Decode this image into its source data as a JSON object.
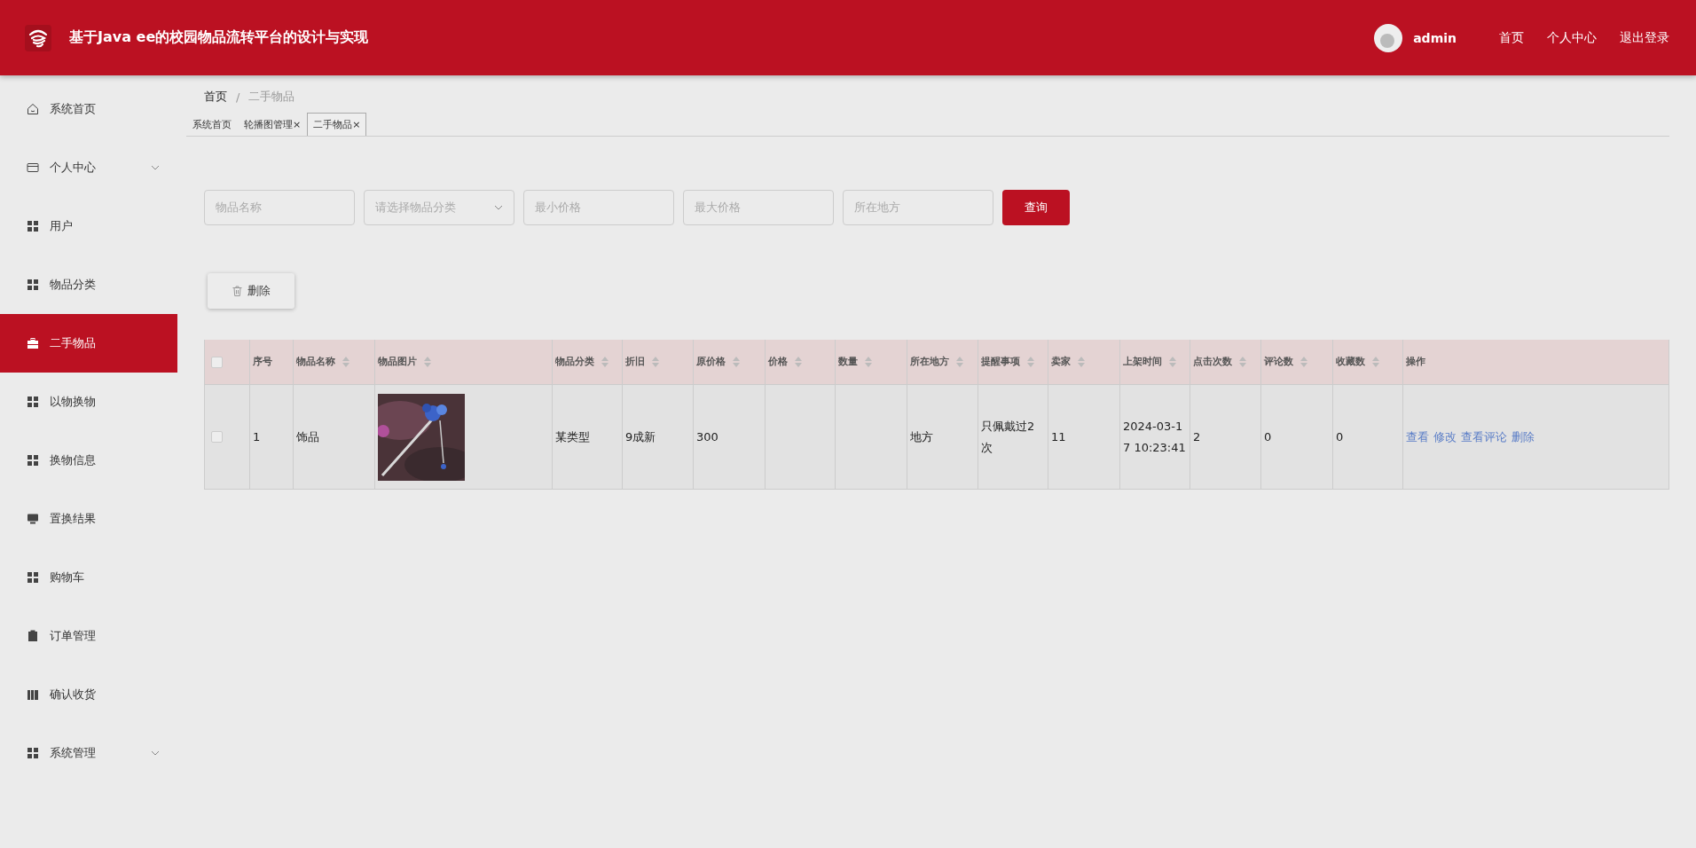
{
  "header": {
    "title": "基于Java ee的校园物品流转平台的设计与实现",
    "user": "admin",
    "links": [
      "首页",
      "个人中心",
      "退出登录"
    ]
  },
  "sidebar": {
    "items": [
      {
        "label": "系统首页",
        "kind": "home",
        "selected": false,
        "expandable": false
      },
      {
        "label": "个人中心",
        "kind": "wallet",
        "selected": false,
        "expandable": true
      },
      {
        "label": "用户",
        "kind": "grid",
        "selected": false,
        "expandable": false
      },
      {
        "label": "物品分类",
        "kind": "grid",
        "selected": false,
        "expandable": false
      },
      {
        "label": "二手物品",
        "kind": "briefcase",
        "selected": true,
        "expandable": false
      },
      {
        "label": "以物换物",
        "kind": "grid",
        "selected": false,
        "expandable": false
      },
      {
        "label": "换物信息",
        "kind": "grid",
        "selected": false,
        "expandable": false
      },
      {
        "label": "置换结果",
        "kind": "monitor",
        "selected": false,
        "expandable": false
      },
      {
        "label": "购物车",
        "kind": "grid",
        "selected": false,
        "expandable": false
      },
      {
        "label": "订单管理",
        "kind": "clipboard",
        "selected": false,
        "expandable": false
      },
      {
        "label": "确认收货",
        "kind": "book",
        "selected": false,
        "expandable": false
      },
      {
        "label": "系统管理",
        "kind": "grid",
        "selected": false,
        "expandable": true
      }
    ]
  },
  "breadcrumb": {
    "items": [
      "首页",
      "二手物品"
    ],
    "separator": "/"
  },
  "tabs": [
    {
      "label": "系统首页",
      "selected": false,
      "closable": false
    },
    {
      "label": "轮播图管理",
      "selected": false,
      "closable": true
    },
    {
      "label": "二手物品",
      "selected": true,
      "closable": true
    }
  ],
  "close_mark": "×",
  "filters": [
    {
      "kind": "input",
      "placeholder": "物品名称"
    },
    {
      "kind": "select",
      "placeholder": "请选择物品分类"
    },
    {
      "kind": "input",
      "placeholder": "最小价格"
    },
    {
      "kind": "input",
      "placeholder": "最大价格"
    },
    {
      "kind": "input",
      "placeholder": "所在地方"
    }
  ],
  "search_button": "查询",
  "delete_button": "删除",
  "table": {
    "select_all": {
      "checked": false
    },
    "columns": [
      {
        "label": "序号",
        "sortable": false
      },
      {
        "label": "物品名称",
        "sortable": true
      },
      {
        "label": "物品图片",
        "sortable": true
      },
      {
        "label": "物品分类",
        "sortable": true
      },
      {
        "label": "折旧",
        "sortable": true
      },
      {
        "label": "原价格",
        "sortable": true
      },
      {
        "label": "价格",
        "sortable": true
      },
      {
        "label": "数量",
        "sortable": true
      },
      {
        "label": "所在地方",
        "sortable": true
      },
      {
        "label": "提醒事项",
        "sortable": true
      },
      {
        "label": "卖家",
        "sortable": true
      },
      {
        "label": "上架时间",
        "sortable": true
      },
      {
        "label": "点击次数",
        "sortable": true
      },
      {
        "label": "评论数",
        "sortable": true
      },
      {
        "label": "收藏数",
        "sortable": true
      },
      {
        "label": "操作",
        "sortable": false
      }
    ],
    "rows": [
      {
        "checked": false,
        "cells": [
          {
            "kind": "text",
            "text": "1"
          },
          {
            "kind": "text",
            "text": "饰品"
          },
          {
            "kind": "picture"
          },
          {
            "kind": "text",
            "text": "某类型"
          },
          {
            "kind": "text",
            "text": "9成新"
          },
          {
            "kind": "text",
            "text": "300"
          },
          {
            "kind": "empty"
          },
          {
            "kind": "empty"
          },
          {
            "kind": "text",
            "text": "地方"
          },
          {
            "kind": "text",
            "text": "只佩戴过2次"
          },
          {
            "kind": "text",
            "text": "11"
          },
          {
            "kind": "text",
            "text": "2024-03-17 10:23:41"
          },
          {
            "kind": "text",
            "text": "2"
          },
          {
            "kind": "text",
            "text": "0"
          },
          {
            "kind": "text",
            "text": "0"
          },
          {
            "kind": "actions",
            "actions": [
              "查看",
              "修改",
              "查看评论",
              "删除"
            ]
          }
        ]
      }
    ]
  }
}
